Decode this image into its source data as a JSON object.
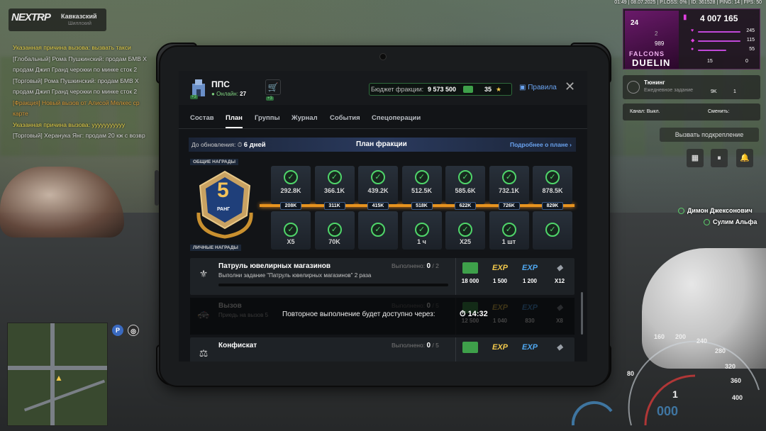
{
  "hud": {
    "server": {
      "logo": "NEXTRP",
      "name": "Кавказский",
      "sub": "Шиллский"
    },
    "topbar": "01:49 | 08.07.2025 | P.LOSS: 0% | ID: 361528 | PING: 14 | FPS: 50",
    "profile": {
      "level": "24",
      "brand": "FALCONS",
      "brand2": "DUELIN",
      "money": "4 007 165",
      "stats": [
        {
          "value": "245",
          "color": "#c048d8"
        },
        {
          "value": "115",
          "color": "#c048d8"
        },
        {
          "value": "55",
          "color": "#c048d8"
        },
        {
          "value": "0",
          "color": "#c048d8"
        }
      ],
      "sub_stats": [
        "989",
        "2"
      ],
      "bottom": [
        "15",
        "0"
      ]
    },
    "tuning": {
      "title": "Тюнинг",
      "sub": "Ежедневное задание",
      "v1": "9K",
      "v2": "1"
    },
    "channel": {
      "label": "Канал: Выкл.",
      "change": "Сменить:"
    },
    "help": "Вызвать подкрепление",
    "voice": [
      {
        "name": "Димон Джексонович"
      },
      {
        "name": "Сулим Альфа"
      }
    ],
    "chat": [
      {
        "text": "Указанная причина вызова: вызвать такси",
        "cls": "c-y"
      },
      {
        "text": "[Глобальный] Рома Пушкинский: продам БМВ X",
        "cls": "c-g"
      },
      {
        "text": "продам Джип Гранд черокки по минке сток 2",
        "cls": "c-g"
      },
      {
        "text": "[Торговый] Рома Пушкинский: продам БМВ X",
        "cls": "c-g"
      },
      {
        "text": "продам Джип Гранд черокки по минке сток 2",
        "cls": "c-g"
      },
      {
        "text": "[Фракция] Новый вызов от Алисой Мелкес ср",
        "cls": "c-o"
      },
      {
        "text": "карте",
        "cls": "c-o"
      },
      {
        "text": "Указанная причина вызова: ууууууууууу",
        "cls": "c-y"
      },
      {
        "text": "[Торговый] Херанука Янг: продам 20 кж с возвр",
        "cls": "c-g"
      }
    ],
    "speedo": {
      "ticks": [
        "80",
        "160",
        "200",
        "240",
        "280",
        "320",
        "360",
        "400"
      ],
      "gear": "1",
      "digits": "000"
    }
  },
  "tablet": {
    "faction": {
      "name": "ППС",
      "online_label": "Онлайн:",
      "online": "27",
      "badge": "+3",
      "cart_badge": "+3"
    },
    "budget": {
      "label": "Бюджет фракции:",
      "value": "9 573 500",
      "stars": "35"
    },
    "rules": "Правила",
    "close": "✕",
    "tabs": [
      "Состав",
      "План",
      "Группы",
      "Журнал",
      "События",
      "Спецоперации"
    ],
    "plan": {
      "update_label": "До обновления:",
      "update_value": "6 дней",
      "title": "План фракции",
      "more": "Подробнее о плане ›",
      "common_rewards": "ОБЩИЕ НАГРАДЫ",
      "personal_rewards": "ЛИЧНЫЕ НАГРАДЫ",
      "rank": "5",
      "rank_label": "РАНГ",
      "common": [
        "292.8K",
        "366.1K",
        "439.2K",
        "512.5K",
        "585.6K",
        "732.1K",
        "878.5K"
      ],
      "milestones": [
        "208K",
        "311K",
        "415K",
        "518K",
        "622K",
        "726K",
        "829K"
      ],
      "personal": [
        "X5",
        "70K",
        "",
        "1 ч",
        "X25",
        "1 шт",
        ""
      ]
    },
    "tasks": [
      {
        "name": "Патруль ювелирных магазинов",
        "desc": "Выполни задание \"Патруль ювелирных магазинов\" 2 раза",
        "done_label": "Выполнено:",
        "done": "0",
        "total": "2",
        "rewards": [
          "18 000",
          "1 500",
          "1 200",
          "X12"
        ]
      },
      {
        "name": "Вызов",
        "desc": "Приедь на вызов 5",
        "done_label": "Выполнено:",
        "done": "0",
        "total": "5",
        "rewards": [
          "12 500",
          "1 040",
          "830",
          "X8"
        ]
      },
      {
        "name": "Конфискат",
        "desc": "",
        "done_label": "Выполнено:",
        "done": "0",
        "total": "5",
        "rewards": [
          "",
          "",
          "",
          ""
        ]
      }
    ],
    "cooldown": {
      "message": "Повторное выполнение будет доступно через:",
      "time": "14:32"
    },
    "reward_icons": {
      "money": "#3ea04a",
      "exp_gold": "#f2c94c",
      "exp_blue": "#4fa8f0",
      "gem": "#9aa0a8"
    }
  }
}
